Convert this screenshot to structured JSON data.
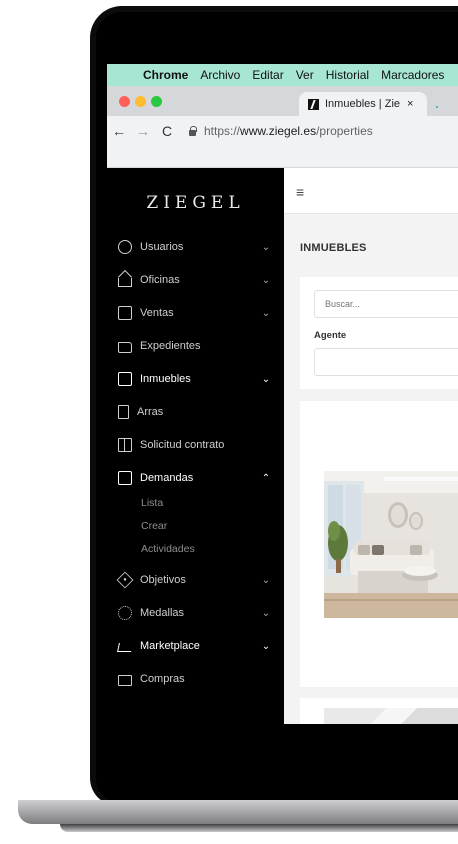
{
  "menubar": {
    "app": "Chrome",
    "items": [
      "Archivo",
      "Editar",
      "Ver",
      "Historial",
      "Marcadores"
    ]
  },
  "browser": {
    "tab_title": "Inmuebles | Zie",
    "tab_close": "×",
    "url_scheme": "https://",
    "url_host": "www.ziegel.es",
    "url_path": "/properties",
    "traffic_colors": [
      "#ff5f57",
      "#febc2e",
      "#28c840"
    ]
  },
  "sidebar": {
    "logo": "ZIEGEL",
    "items": [
      {
        "label": "Usuarios",
        "icon": "user-circle-icon",
        "chevron": "⌄"
      },
      {
        "label": "Oficinas",
        "icon": "home-icon",
        "chevron": "⌄"
      },
      {
        "label": "Ventas",
        "icon": "building-icon",
        "chevron": "⌄"
      },
      {
        "label": "Expedientes",
        "icon": "folder-icon",
        "chevron": ""
      },
      {
        "label": "Inmuebles",
        "icon": "property-icon",
        "chevron": "⌄"
      },
      {
        "label": "Arras",
        "icon": "document-icon",
        "chevron": ""
      },
      {
        "label": "Solicitud contrato",
        "icon": "book-icon",
        "chevron": ""
      },
      {
        "label": "Demandas",
        "icon": "clipboard-icon",
        "chevron": "⌃"
      },
      {
        "label": "Objetivos",
        "icon": "target-icon",
        "chevron": "⌄"
      },
      {
        "label": "Medallas",
        "icon": "medal-icon",
        "chevron": "⌄"
      },
      {
        "label": "Marketplace",
        "icon": "cart-icon",
        "chevron": "⌄"
      },
      {
        "label": "Compras",
        "icon": "bag-icon",
        "chevron": ""
      }
    ],
    "demandas_subitems": [
      "Lista",
      "Crear",
      "Actividades"
    ]
  },
  "main": {
    "menu_icon": "≡",
    "title": "INMUEBLES",
    "search_placeholder": "Buscar...",
    "agent_label": "Agente"
  },
  "colors": {
    "menubar": "#a8e6d4",
    "sidebar": "#000000",
    "content_bg": "#f3f3f3"
  }
}
